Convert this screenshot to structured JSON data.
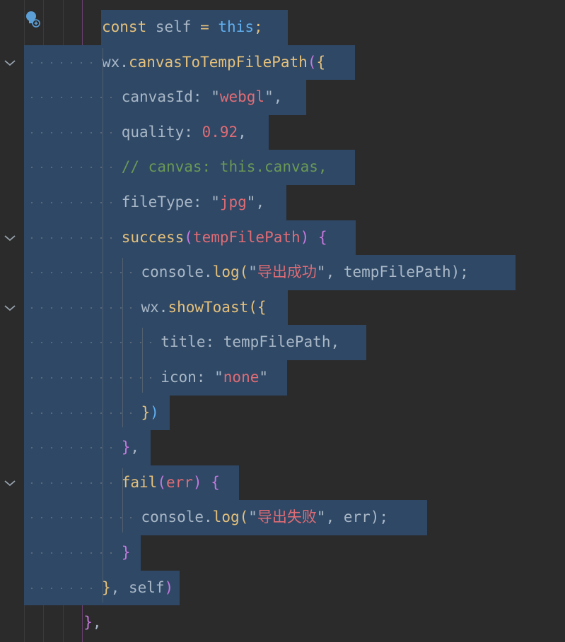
{
  "editor": {
    "colors": {
      "background": "#2b2b2b",
      "selection": "#2e4866",
      "keyword": "#cc7832",
      "identifier": "#a9b7c6",
      "function": "#ffc66d",
      "string": "#6a8759",
      "string_bright": "#e06c75",
      "number": "#e06c75",
      "comment": "#629755",
      "this": "#9876aa",
      "bracket_gold": "#e5c07b",
      "bracket_purple": "#c678dd",
      "bracket_blue": "#61afef"
    },
    "lines": [
      {
        "indent": 5,
        "fold": false,
        "sel_start": 143,
        "sel_end": 407,
        "tokens": [
          {
            "t": "const",
            "c": "#e5c07b"
          },
          {
            "t": " self ",
            "c": "#a9b7c6"
          },
          {
            "t": "=",
            "c": "#e5c07b"
          },
          {
            "t": " ",
            "c": "#a9b7c6"
          },
          {
            "t": "this",
            "c": "#61afef"
          },
          {
            "t": ";",
            "c": "#e5c07b"
          }
        ]
      },
      {
        "indent": 5,
        "fold": true,
        "sel_start": 34,
        "sel_end": 502,
        "tokens": [
          {
            "t": "wx",
            "c": "#a9b7c6"
          },
          {
            "t": ".",
            "c": "#a9b7c6"
          },
          {
            "t": "canvasToTempFilePath",
            "c": "#e5c07b"
          },
          {
            "t": "(",
            "c": "#c678dd"
          },
          {
            "t": "{",
            "c": "#e5c07b"
          }
        ]
      },
      {
        "indent": 6,
        "fold": false,
        "sel_start": 34,
        "sel_end": 433,
        "tokens": [
          {
            "t": "canvasId",
            "c": "#a9b7c6"
          },
          {
            "t": ": ",
            "c": "#a9b7c6"
          },
          {
            "t": "\"",
            "c": "#a9b7c6"
          },
          {
            "t": "webgl",
            "c": "#e06c75"
          },
          {
            "t": "\"",
            "c": "#a9b7c6"
          },
          {
            "t": ",",
            "c": "#a9b7c6"
          }
        ]
      },
      {
        "indent": 6,
        "fold": false,
        "sel_start": 34,
        "sel_end": 380,
        "tokens": [
          {
            "t": "quality",
            "c": "#a9b7c6"
          },
          {
            "t": ": ",
            "c": "#a9b7c6"
          },
          {
            "t": "0.92",
            "c": "#e06c75"
          },
          {
            "t": ",",
            "c": "#a9b7c6"
          }
        ]
      },
      {
        "indent": 6,
        "fold": false,
        "sel_start": 34,
        "sel_end": 502,
        "tokens": [
          {
            "t": "// canvas: this.canvas,",
            "c": "#6a9955"
          }
        ]
      },
      {
        "indent": 6,
        "fold": false,
        "sel_start": 34,
        "sel_end": 405,
        "tokens": [
          {
            "t": "fileType",
            "c": "#a9b7c6"
          },
          {
            "t": ": ",
            "c": "#a9b7c6"
          },
          {
            "t": "\"",
            "c": "#a9b7c6"
          },
          {
            "t": "jpg",
            "c": "#e06c75"
          },
          {
            "t": "\"",
            "c": "#a9b7c6"
          },
          {
            "t": ",",
            "c": "#a9b7c6"
          }
        ]
      },
      {
        "indent": 6,
        "fold": true,
        "sel_start": 34,
        "sel_end": 503,
        "tokens": [
          {
            "t": "success",
            "c": "#e5c07b"
          },
          {
            "t": "(",
            "c": "#c678dd"
          },
          {
            "t": "tempFilePath",
            "c": "#e06c75"
          },
          {
            "t": ") ",
            "c": "#c678dd"
          },
          {
            "t": "{",
            "c": "#c678dd"
          }
        ]
      },
      {
        "indent": 7,
        "fold": false,
        "sel_start": 34,
        "sel_end": 729,
        "tokens": [
          {
            "t": "console",
            "c": "#a9b7c6"
          },
          {
            "t": ".",
            "c": "#a9b7c6"
          },
          {
            "t": "log",
            "c": "#e5c07b"
          },
          {
            "t": "(",
            "c": "#e5c07b"
          },
          {
            "t": "\"",
            "c": "#a9b7c6"
          },
          {
            "t": "导出成功",
            "c": "#e06c75"
          },
          {
            "t": "\"",
            "c": "#a9b7c6"
          },
          {
            "t": ", tempFilePath);",
            "c": "#a9b7c6"
          }
        ]
      },
      {
        "indent": 7,
        "fold": true,
        "sel_start": 34,
        "sel_end": 407,
        "tokens": [
          {
            "t": "wx",
            "c": "#a9b7c6"
          },
          {
            "t": ".",
            "c": "#a9b7c6"
          },
          {
            "t": "showToast",
            "c": "#e5c07b"
          },
          {
            "t": "(",
            "c": "#e5c07b"
          },
          {
            "t": "{",
            "c": "#e5c07b"
          }
        ]
      },
      {
        "indent": 8,
        "fold": false,
        "sel_start": 34,
        "sel_end": 518,
        "tokens": [
          {
            "t": "title",
            "c": "#a9b7c6"
          },
          {
            "t": ": tempFilePath,",
            "c": "#a9b7c6"
          }
        ]
      },
      {
        "indent": 8,
        "fold": false,
        "sel_start": 34,
        "sel_end": 406,
        "tokens": [
          {
            "t": "icon",
            "c": "#a9b7c6"
          },
          {
            "t": ": ",
            "c": "#a9b7c6"
          },
          {
            "t": "\"",
            "c": "#a9b7c6"
          },
          {
            "t": "none",
            "c": "#e06c75"
          },
          {
            "t": "\"",
            "c": "#a9b7c6"
          }
        ]
      },
      {
        "indent": 7,
        "fold": false,
        "sel_start": 34,
        "sel_end": 240,
        "tokens": [
          {
            "t": "}",
            "c": "#e5c07b"
          },
          {
            "t": ")",
            "c": "#61afef"
          }
        ]
      },
      {
        "indent": 6,
        "fold": false,
        "sel_start": 34,
        "sel_end": 213,
        "tokens": [
          {
            "t": "}",
            "c": "#c678dd"
          },
          {
            "t": ",",
            "c": "#a9b7c6"
          }
        ]
      },
      {
        "indent": 6,
        "fold": true,
        "sel_start": 34,
        "sel_end": 338,
        "tokens": [
          {
            "t": "fail",
            "c": "#e5c07b"
          },
          {
            "t": "(",
            "c": "#c678dd"
          },
          {
            "t": "err",
            "c": "#e06c75"
          },
          {
            "t": ") ",
            "c": "#c678dd"
          },
          {
            "t": "{",
            "c": "#c678dd"
          }
        ]
      },
      {
        "indent": 7,
        "fold": false,
        "sel_start": 34,
        "sel_end": 604,
        "tokens": [
          {
            "t": "console",
            "c": "#a9b7c6"
          },
          {
            "t": ".",
            "c": "#a9b7c6"
          },
          {
            "t": "log",
            "c": "#e5c07b"
          },
          {
            "t": "(",
            "c": "#e5c07b"
          },
          {
            "t": "\"",
            "c": "#a9b7c6"
          },
          {
            "t": "导出失败",
            "c": "#e06c75"
          },
          {
            "t": "\"",
            "c": "#a9b7c6"
          },
          {
            "t": ", err);",
            "c": "#a9b7c6"
          }
        ]
      },
      {
        "indent": 6,
        "fold": false,
        "sel_start": 34,
        "sel_end": 199,
        "tokens": [
          {
            "t": "}",
            "c": "#c678dd"
          }
        ]
      },
      {
        "indent": 5,
        "fold": false,
        "sel_start": 34,
        "sel_end": 254,
        "tokens": [
          {
            "t": "}",
            "c": "#e5c07b"
          },
          {
            "t": ", self",
            "c": "#a9b7c6"
          },
          {
            "t": ")",
            "c": "#c678dd"
          }
        ]
      },
      {
        "indent": 4,
        "fold": false,
        "sel_start": null,
        "sel_end": null,
        "tokens": [
          {
            "t": "}",
            "c": "#c678dd"
          },
          {
            "t": ",",
            "c": "#a9b7c6"
          }
        ]
      }
    ]
  }
}
